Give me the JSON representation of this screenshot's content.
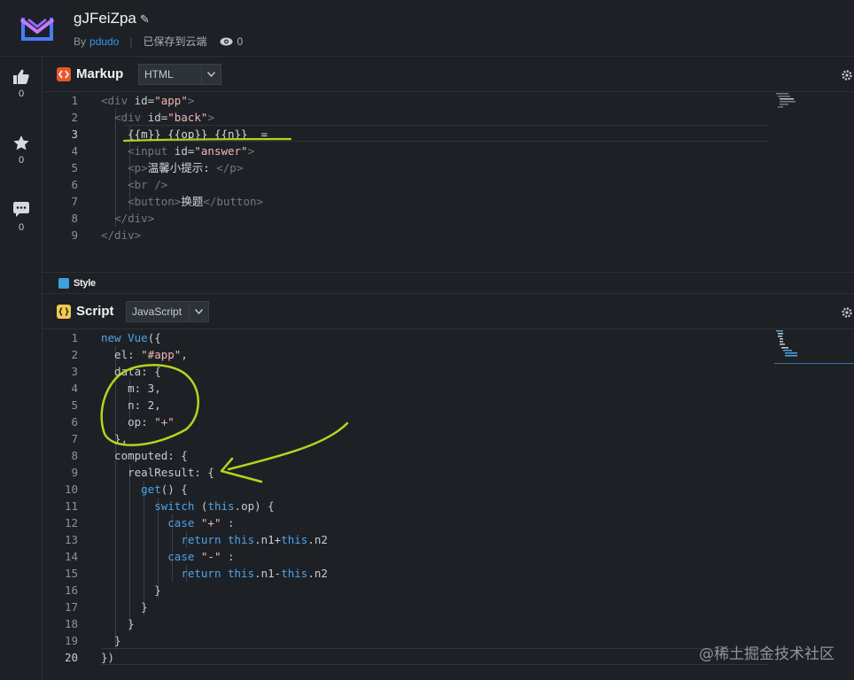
{
  "header": {
    "title": "gJFeiZpa",
    "by_label": "By",
    "author": "pdudo",
    "save_status": "已保存到云端",
    "view_count": "0"
  },
  "rail": {
    "likes": "0",
    "stars": "0",
    "comments": "0"
  },
  "markup": {
    "title": "Markup",
    "language": "HTML",
    "lines": [
      {
        "n": "1"
      },
      {
        "n": "2"
      },
      {
        "n": "3"
      },
      {
        "n": "4"
      },
      {
        "n": "5"
      },
      {
        "n": "6"
      },
      {
        "n": "7"
      },
      {
        "n": "8"
      },
      {
        "n": "9"
      }
    ],
    "text": {
      "l3": "{{m}} {{op}} {{n}}  =",
      "l5_text": "温馨小提示: ",
      "l7_text": "换题"
    }
  },
  "style": {
    "title": "Style"
  },
  "script": {
    "title": "Script",
    "language": "JavaScript"
  },
  "watermark": "@稀土掘金技术社区",
  "colors": {
    "background": "#1d2126",
    "keyword": "#4ea3e8",
    "string": "#f2b5b5",
    "annotation": "#b5d41e",
    "author_link": "#3b95e8"
  }
}
